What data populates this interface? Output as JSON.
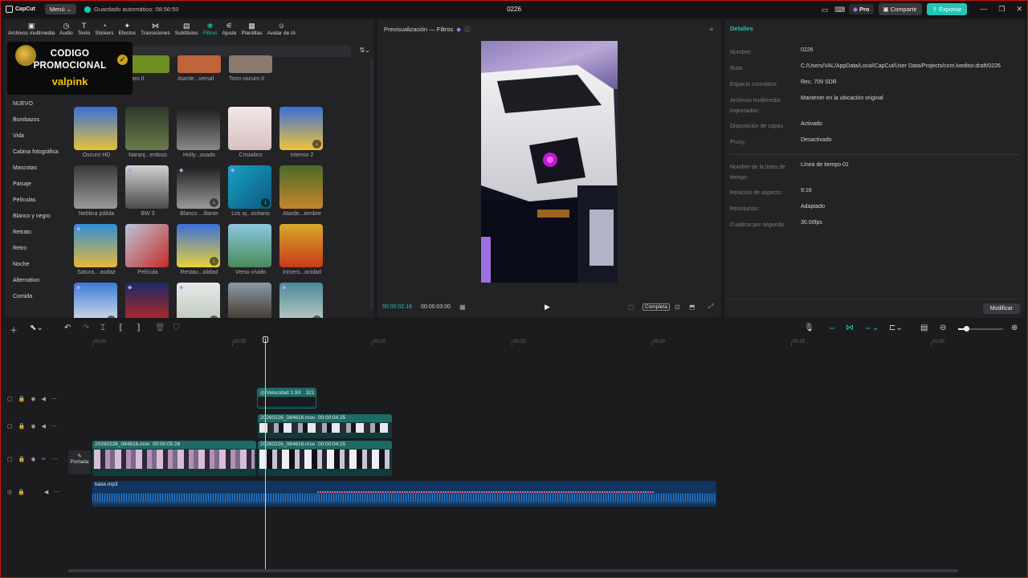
{
  "titlebar": {
    "app_name": "CapCut",
    "menu_label": "Menú",
    "autosave": "Guardado automático: 08:56:50",
    "project": "0226",
    "pro_label": "Pro",
    "share_label": "Compartir",
    "export_label": "Exportar"
  },
  "tools": [
    {
      "label": "Archivos multimedia",
      "icon": "media-icon"
    },
    {
      "label": "Audio",
      "icon": "audio-icon"
    },
    {
      "label": "Texto",
      "icon": "text-icon"
    },
    {
      "label": "Stickers",
      "icon": "sticker-icon"
    },
    {
      "label": "Efectos",
      "icon": "effects-icon"
    },
    {
      "label": "Transiciones",
      "icon": "transition-icon"
    },
    {
      "label": "Subtítulos",
      "icon": "subtitle-icon"
    },
    {
      "label": "Filtros",
      "icon": "filter-icon",
      "active": true
    },
    {
      "label": "Ajuste",
      "icon": "adjust-icon"
    },
    {
      "label": "Plantillas",
      "icon": "templates-icon"
    },
    {
      "label": "Avatar de IA",
      "icon": "avatar-icon"
    }
  ],
  "promo": {
    "line1": "CODIGO",
    "line2": "PROMOCIONAL",
    "line3": "valpink"
  },
  "categories": [
    "NUEVO",
    "Bombazos",
    "Vida",
    "Cabina fotográfica",
    "Mascotas",
    "Paisaje",
    "Películas",
    "Blanco y negro",
    "Retrato",
    "Retro",
    "Noche",
    "Alternativo",
    "Comida"
  ],
  "top_row": [
    "...ma fresca",
    "Claro II",
    "Atarde...versal",
    "Tono oscuro II"
  ],
  "filters": [
    [
      "Oscuro HD",
      "Naranj...erdoso",
      "Holly...asado",
      "Cristalino",
      "Intenso 2"
    ],
    [
      "Neblina pálida",
      "BW 3",
      "Blanco ...illante",
      "Los oj...océano",
      "Atarde...iembre"
    ],
    [
      "Satura... audaz",
      "Película",
      "Restau...alidad",
      "Verso vívido",
      "Inmers...ocidad"
    ],
    [
      "Estudi...scotas",
      "Fiesta... noche",
      "Medio...blado",
      "Daisies Glow",
      "Luces ...turnas"
    ]
  ],
  "preview": {
    "title": "Previsualización — Filtros",
    "current_time": "00:00:02:18",
    "total_time": "00:00:03:00",
    "full_label": "Completa"
  },
  "details": {
    "title": "Detalles",
    "rows": [
      {
        "key": "Nombre:",
        "value": "0226"
      },
      {
        "key": "Ruta:",
        "value": "C:/Users/VAL/AppData/Local/CapCut/User Data/Projects/com.lveditor.draft/0226"
      },
      {
        "key": "Espacio cromático:",
        "value": "Rec. 709 SDR"
      },
      {
        "key": "Archivos multimedia importados:",
        "value": "Mantener en la ubicación original"
      },
      {
        "key": "Disposición de capas",
        "value": "Activado"
      },
      {
        "key": "Proxy:",
        "value": "Desactivado"
      },
      {
        "key": "Nombre de la línea de tiempo",
        "value": "Línea de tiempo 01"
      },
      {
        "key": "Relación de aspecto:",
        "value": "9:16"
      },
      {
        "key": "Resolución:",
        "value": "Adaptado"
      },
      {
        "key": "Cuadros por segundo:",
        "value": "30.00fps"
      }
    ],
    "modify_label": "Modificar"
  },
  "timeline": {
    "ruler": [
      "00:00",
      "00:05",
      "00:10",
      "00:15",
      "00:20",
      "00:25",
      "00:30"
    ],
    "cover_label": "Portada",
    "speed_clip": {
      "label": "Velocidad 1.9X",
      "badge": "321"
    },
    "overlay_clip": {
      "name": "20260226_084616.mov",
      "duration": "00:00:04:25"
    },
    "main_clip_a": {
      "name": "20260226_084616.mov",
      "duration": "00:00:05:26"
    },
    "main_clip_b": {
      "name": "20260226_084616.mov",
      "duration": "00:00:04:25"
    },
    "audio_clip": {
      "name": "base.mp3"
    }
  },
  "colors": {
    "accent": "#21c6b4",
    "panel": "#232326",
    "background": "#1a1a1c",
    "promo_yellow": "#f5c400"
  }
}
